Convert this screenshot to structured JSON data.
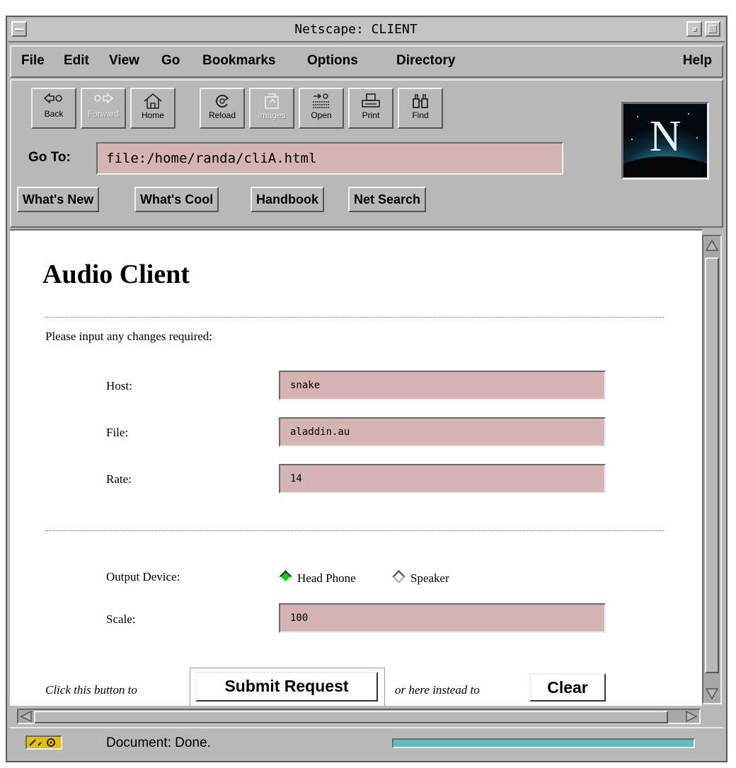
{
  "window": {
    "title": "Netscape: CLIENT"
  },
  "menu": [
    "File",
    "Edit",
    "View",
    "Go",
    "Bookmarks",
    "Options",
    "Directory",
    "Help"
  ],
  "toolbar": {
    "back": "Back",
    "forward": "Forward",
    "home": "Home",
    "reload": "Reload",
    "images": "Images",
    "open": "Open",
    "print": "Print",
    "find": "Find"
  },
  "location": {
    "label": "Go To:",
    "url": "file:/home/randa/cliA.html"
  },
  "directory_buttons": [
    "What's New",
    "What's Cool",
    "Handbook",
    "Net Search"
  ],
  "logo_letter": "N",
  "page": {
    "heading": "Audio Client",
    "intro": "Please input any changes required:",
    "host_label": "Host:",
    "host_value": "snake",
    "file_label": "File:",
    "file_value": "aladdin.au",
    "rate_label": "Rate:",
    "rate_value": "14",
    "output_label": "Output Device:",
    "output_options": [
      "Head Phone",
      "Speaker"
    ],
    "output_selected": "Head Phone",
    "scale_label": "Scale:",
    "scale_value": "100",
    "submit_prefix": "Click this button to",
    "submit_label": "Submit Request",
    "clear_prefix": "or here instead to",
    "clear_label": "Clear"
  },
  "status": {
    "text": "Document: Done."
  },
  "colors": {
    "chrome": "#b8b8b8",
    "field": "#d4b4b4",
    "radio_on": "#14c814",
    "progress": "#5fbfbf"
  }
}
